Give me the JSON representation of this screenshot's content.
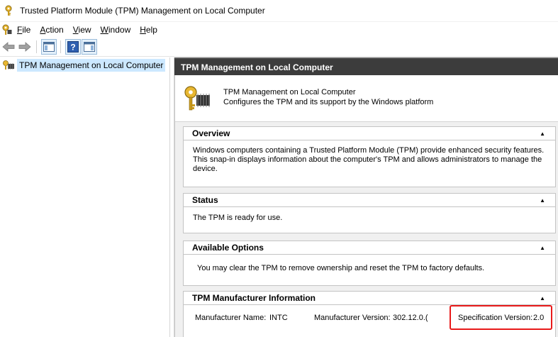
{
  "window": {
    "title": "Trusted Platform Module (TPM) Management on Local Computer"
  },
  "menu": [
    {
      "key": "F",
      "rest": "ile"
    },
    {
      "key": "A",
      "rest": "ction"
    },
    {
      "key": "V",
      "rest": "iew"
    },
    {
      "key": "W",
      "rest": "indow"
    },
    {
      "key": "H",
      "rest": "elp"
    }
  ],
  "tree": {
    "root_label": "TPM Management on Local Computer"
  },
  "panel": {
    "header": "TPM Management on Local Computer",
    "intro_title": "TPM Management on Local Computer",
    "intro_desc": "Configures the TPM and its support by the Windows platform"
  },
  "sections": {
    "overview": {
      "title": "Overview",
      "text": "Windows computers containing a Trusted Platform Module (TPM) provide enhanced security features. This snap-in displays information about the computer's TPM and allows administrators to manage the device."
    },
    "status": {
      "title": "Status",
      "text": "The TPM is ready for use."
    },
    "options": {
      "title": "Available Options",
      "text": "You may clear the TPM to remove ownership and reset the TPM to factory defaults."
    },
    "manufacturer": {
      "title": "TPM Manufacturer Information",
      "name_label": "Manufacturer Name:",
      "name_value": "INTC",
      "version_label": "Manufacturer Version:",
      "version_value": "302.12.0.(",
      "spec_label": "Specification Version:",
      "spec_value": "2.0"
    }
  },
  "colors": {
    "header_bg": "#3c3c3c",
    "selection": "#cce8ff",
    "highlight": "#e81a1a"
  }
}
